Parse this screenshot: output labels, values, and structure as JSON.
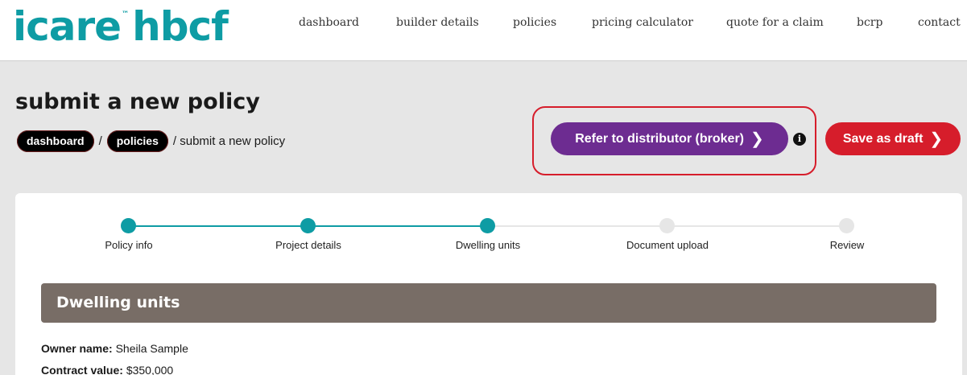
{
  "header": {
    "logo_main": "icare",
    "logo_tm": "™",
    "logo_sub": "hbcf",
    "nav": [
      "dashboard",
      "builder details",
      "policies",
      "pricing calculator",
      "quote for a claim",
      "bcrp",
      "contact"
    ]
  },
  "page": {
    "title": "submit a new policy",
    "breadcrumb": {
      "items": [
        "dashboard",
        "policies"
      ],
      "separator": "/",
      "current": "/ submit a new policy"
    }
  },
  "actions": {
    "refer_label": "Refer to distributor (broker)",
    "draft_label": "Save as draft",
    "chevron": "❯",
    "info_glyph": "i"
  },
  "stepper": {
    "steps": [
      {
        "label": "Policy info",
        "done": true
      },
      {
        "label": "Project details",
        "done": true
      },
      {
        "label": "Dwelling units",
        "done": true
      },
      {
        "label": "Document upload",
        "done": false
      },
      {
        "label": "Review",
        "done": false
      }
    ]
  },
  "section": {
    "title": "Dwelling units",
    "fields": [
      {
        "label": "Owner name:",
        "value": "Sheila Sample"
      },
      {
        "label": "Contract value:",
        "value": "$350,000"
      }
    ]
  },
  "colors": {
    "brand_teal": "#0e9ca4",
    "refer_purple": "#6d2c91",
    "draft_red": "#d61d2b",
    "highlight_red": "#d61d2b",
    "section_brown": "#786d66"
  }
}
